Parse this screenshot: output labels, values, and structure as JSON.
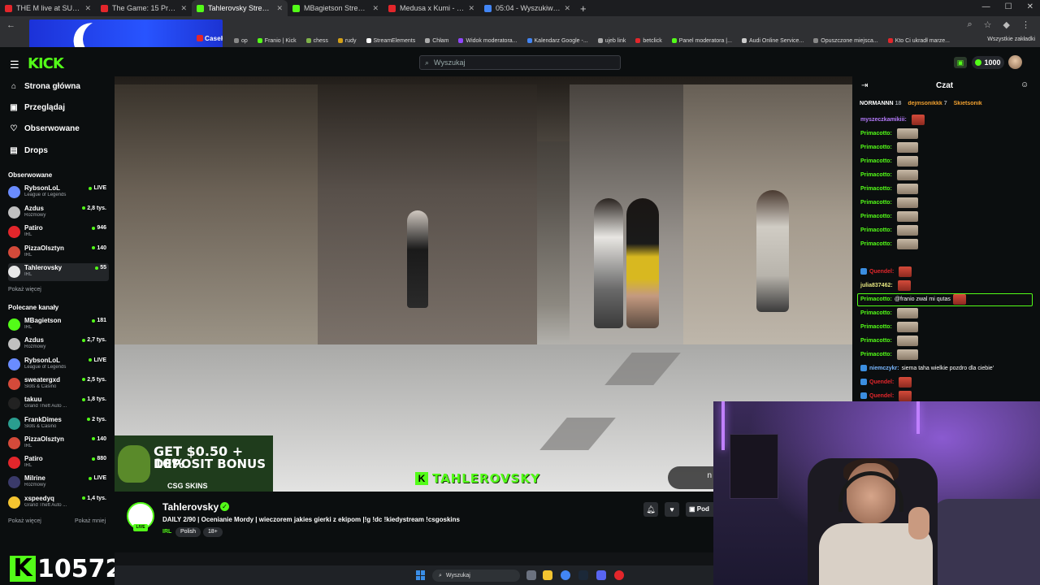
{
  "browser": {
    "tabs": [
      {
        "title": "THE M live at SUNRISE FESTIVAL",
        "color": "#e3262b",
        "active": false
      },
      {
        "title": "The Game: 15 Prawilniaków vs",
        "color": "#e3262b",
        "active": false
      },
      {
        "title": "Tahlerovsky Stream - Watch",
        "color": "#53fc18",
        "active": true
      },
      {
        "title": "MBagietson Stream - Watch Li",
        "color": "#53fc18",
        "active": false
      },
      {
        "title": "Medusa x Kumi - Wlewam do g",
        "color": "#e3262b",
        "active": false
      },
      {
        "title": "05:04 - Wyszukiwarka Google",
        "color": "#4285f4",
        "active": false
      }
    ],
    "bookmarks": [
      {
        "label": "op",
        "color": "#888"
      },
      {
        "label": "Franio | Kick",
        "color": "#53fc18"
      },
      {
        "label": "chess",
        "color": "#7fb24a"
      },
      {
        "label": "rudy",
        "color": "#d4a017"
      },
      {
        "label": "StreamElements",
        "color": "#ffffff"
      },
      {
        "label": "Chłam",
        "color": "#aaaaaa"
      },
      {
        "label": "Widok moderatora...",
        "color": "#9146ff"
      },
      {
        "label": "Kalendarz Google -...",
        "color": "#4285f4"
      },
      {
        "label": "ujeb link",
        "color": "#aaaaaa"
      },
      {
        "label": "betclick",
        "color": "#e3262b"
      },
      {
        "label": "Panel moderatora |...",
        "color": "#53fc18"
      },
      {
        "label": "Audi Online Service...",
        "color": "#cccccc"
      },
      {
        "label": "Opuszczone miejsca...",
        "color": "#888888"
      },
      {
        "label": "Kto Ci ukradł marze...",
        "color": "#e3262b"
      }
    ],
    "all_bookmarks": "Wszystkie zakładki"
  },
  "ad": {
    "brand": "CaseHug"
  },
  "header": {
    "logo": "KICK",
    "search_placeholder": "Wyszukaj",
    "points": "1000"
  },
  "sidebar": {
    "nav": [
      {
        "label": "Strona główna",
        "icon": "home-icon",
        "glyph": "⌂"
      },
      {
        "label": "Przeglądaj",
        "icon": "browse-icon",
        "glyph": "▣"
      },
      {
        "label": "Obserwowane",
        "icon": "heart-icon",
        "glyph": "♡"
      },
      {
        "label": "Drops",
        "icon": "drops-icon",
        "glyph": "▤"
      }
    ],
    "followed_heading": "Obserwowane",
    "followed": [
      {
        "name": "RybsonLoL",
        "category": "League of Legends",
        "viewers": "LIVE",
        "avatar": "#6a8cff"
      },
      {
        "name": "Azdus",
        "category": "Rozmowy",
        "viewers": "2,8 tys.",
        "avatar": "#c0c0c0"
      },
      {
        "name": "Patiro",
        "category": "IRL",
        "viewers": "946",
        "avatar": "#e3262b"
      },
      {
        "name": "PizzaOlsztyn",
        "category": "IRL",
        "viewers": "140",
        "avatar": "#d44a3a"
      },
      {
        "name": "Tahlerovsky",
        "category": "IRL",
        "viewers": "55",
        "avatar": "#e8e8e8"
      }
    ],
    "show_more": "Pokaż więcej",
    "recommended_heading": "Polecane kanały",
    "recommended": [
      {
        "name": "MBagietson",
        "category": "IRL",
        "viewers": "181",
        "avatar": "#53fc18"
      },
      {
        "name": "Azdus",
        "category": "Rozmowy",
        "viewers": "2,7 tys.",
        "avatar": "#c0c0c0"
      },
      {
        "name": "RybsonLoL",
        "category": "League of Legends",
        "viewers": "LIVE",
        "avatar": "#6a8cff"
      },
      {
        "name": "sweatergxd",
        "category": "Slots & Casino",
        "viewers": "2,5 tys.",
        "avatar": "#d44a3a"
      },
      {
        "name": "takuu",
        "category": "Grand Theft Auto ...",
        "viewers": "1,8 tys.",
        "avatar": "#222"
      },
      {
        "name": "FrankDimes",
        "category": "Slots & Casino",
        "viewers": "2 tys.",
        "avatar": "#2a9d8f"
      },
      {
        "name": "PizzaOlsztyn",
        "category": "IRL",
        "viewers": "140",
        "avatar": "#d44a3a"
      },
      {
        "name": "Patiro",
        "category": "IRL",
        "viewers": "880",
        "avatar": "#e3262b"
      },
      {
        "name": "Milrine",
        "category": "Rozmowy",
        "viewers": "LIVE",
        "avatar": "#3a3a6a"
      },
      {
        "name": "xspeedyq",
        "category": "Grand Theft Auto ...",
        "viewers": "1,4 tys.",
        "avatar": "#f4c430"
      }
    ],
    "show_more2": "Pokaż więcej",
    "show_less": "Pokaż mniej",
    "kick_counter": "10572"
  },
  "video": {
    "overlay_ad_line1": "GET $0.50 + 10%",
    "overlay_ad_line2": "DEPOSIT BONUS",
    "overlay_ad_brand": "CSG SKINS",
    "watermark": "TAHLEROVSKY"
  },
  "stream": {
    "channel": "Tahlerovsky",
    "live": "LIVE",
    "title": "DAILY 2/90 | Ocenianie Mordy | wieczorem jakies gierki z ekipom |!g !dc !kiedystream !csgoskins",
    "category": "IRL",
    "tags": [
      "Polish",
      "18+"
    ],
    "subscribe_label": "Pod"
  },
  "chat": {
    "title": "Czat",
    "pinned": [
      {
        "name": "NORMANNN",
        "value": "18",
        "color": "#ffffff"
      },
      {
        "name": "dejmsonikkk",
        "value": "7",
        "color": "#f0a030"
      },
      {
        "name": "Skietsonik",
        "value": "",
        "color": "#f0a030"
      }
    ],
    "messages": [
      {
        "user": "myszeczkamikiii:",
        "color": "#b77cff",
        "text": "",
        "emote": "red"
      },
      {
        "user": "Primacotto:",
        "color": "#53fc18",
        "text": "",
        "emote": "face"
      },
      {
        "user": "Primacotto:",
        "color": "#53fc18",
        "text": "",
        "emote": "face"
      },
      {
        "user": "Primacotto:",
        "color": "#53fc18",
        "text": "",
        "emote": "face"
      },
      {
        "user": "Primacotto:",
        "color": "#53fc18",
        "text": "",
        "emote": "face"
      },
      {
        "user": "Primacotto:",
        "color": "#53fc18",
        "text": "",
        "emote": "face"
      },
      {
        "user": "Primacotto:",
        "color": "#53fc18",
        "text": "",
        "emote": "face"
      },
      {
        "user": "Primacotto:",
        "color": "#53fc18",
        "text": "",
        "emote": "face"
      },
      {
        "user": "Primacotto:",
        "color": "#53fc18",
        "text": "",
        "emote": "face"
      },
      {
        "user": "Primacotto:",
        "color": "#53fc18",
        "text": "",
        "emote": "face"
      },
      {
        "user": "Quendel:",
        "color": "#e3262b",
        "text": "",
        "emote": "red"
      },
      {
        "user": "julia837462:",
        "color": "#e6e680",
        "text": "",
        "emote": "red"
      },
      {
        "user": "Primacotto:",
        "color": "#53fc18",
        "text": "@franio zwal mi qutas",
        "emote": "red"
      },
      {
        "user": "Primacotto:",
        "color": "#53fc18",
        "text": "",
        "emote": "face"
      },
      {
        "user": "Primacotto:",
        "color": "#53fc18",
        "text": "",
        "emote": "face"
      },
      {
        "user": "Primacotto:",
        "color": "#53fc18",
        "text": "",
        "emote": "face"
      },
      {
        "user": "Primacotto:",
        "color": "#53fc18",
        "text": "",
        "emote": "face"
      },
      {
        "user": "niemczykr:",
        "color": "#7ab8ff",
        "text": "siema taha wielkie pozdro dla ciebie'",
        "emote": ""
      },
      {
        "user": "Quendel:",
        "color": "#e3262b",
        "text": "",
        "emote": "red"
      },
      {
        "user": "Quendel:",
        "color": "#e3262b",
        "text": "",
        "emote": "red"
      }
    ]
  },
  "taskbar": {
    "search": "Wyszukaj"
  }
}
